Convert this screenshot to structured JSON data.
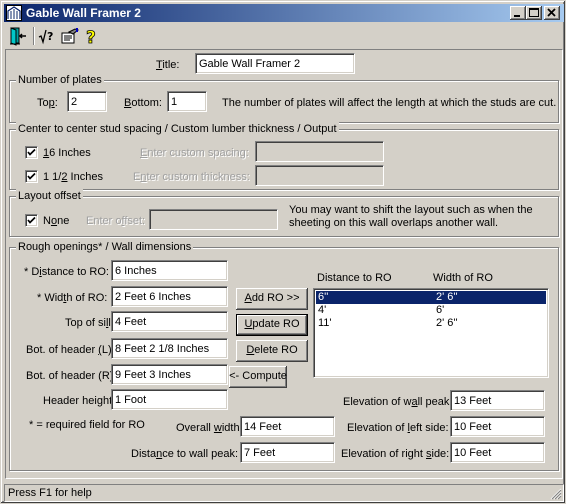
{
  "window": {
    "title": "Gable Wall Framer 2",
    "controls": {
      "minimize": "_",
      "maximize": "□",
      "close": "✕"
    }
  },
  "toolbar": {
    "icons": [
      "exit-door-icon",
      "calculator-sqrt-icon",
      "properties-icon",
      "help-icon"
    ]
  },
  "title_field": {
    "label": "Title:",
    "accel": "T",
    "label_rest": "itle:",
    "value": "Gable Wall Framer 2"
  },
  "plates": {
    "group_title": "Number of plates",
    "top_label_pre": "To",
    "top_label_accel": "p",
    "top_label_post": ":",
    "top_value": "2",
    "bottom_label_accel": "B",
    "bottom_label_post": "ottom:",
    "bottom_value": "1",
    "note": "The number of plates will affect the length at which the studs are cut."
  },
  "spacing": {
    "group_title": "Center to center stud spacing / Custom lumber thickness / Output",
    "spacing_check": {
      "accel": "1",
      "rest": "6 Inches",
      "checked": true
    },
    "thickness_check": {
      "pre": "1 1/",
      "accel": "2",
      "rest": " Inches",
      "checked": true
    },
    "custom_spacing_label_accel": "E",
    "custom_spacing_label_rest": "nter custom spacing:",
    "custom_spacing_value": "",
    "custom_thickness_label_pre": "E",
    "custom_thickness_label_accel": "n",
    "custom_thickness_label_rest": "ter custom thickness:",
    "custom_thickness_value": ""
  },
  "layout": {
    "group_title": "Layout offset",
    "none_check": {
      "pre": "N",
      "accel": "o",
      "rest": "ne",
      "checked": true
    },
    "offset_label_pre": "Enter o",
    "offset_label_accel": "f",
    "offset_label_rest": "fset:",
    "offset_value": "",
    "note_line1": "You may want to shift the layout such as when the",
    "note_line2": "sheeting on this wall overlaps another wall."
  },
  "rough": {
    "group_title": "Rough openings* / Wall dimensions",
    "distance_label_pre": "* D",
    "distance_label_accel": "i",
    "distance_label_rest": "stance to RO:",
    "distance_value": "6 Inches",
    "width_label_pre": "* Wid",
    "width_label_accel": "t",
    "width_label_rest": "h of RO:",
    "width_value": "2 Feet 6 Inches",
    "sill_label_pre": "Top of si",
    "sill_label_accel": "l",
    "sill_label_rest": "l:",
    "sill_value": "4 Feet",
    "header_l_label_pre": "Bot. of header ",
    "header_l_label_accel": "(",
    "header_l_label_rest": "L):",
    "header_l_value": "8 Feet 2 1/8 Inches",
    "header_r_label": "Bot. of header (R):",
    "header_r_value": "9 Feet 3 Inches",
    "header_h_label_pre": "Header hei",
    "header_h_label_accel": "g",
    "header_h_label_rest": "ht:",
    "header_h_value": "1 Foot",
    "required_note": "* = required field for RO",
    "buttons": {
      "add_accel": "A",
      "add_rest": "dd RO >>",
      "update_accel": "U",
      "update_rest": "pdate RO",
      "delete_accel": "D",
      "delete_rest": "elete RO",
      "compute": "<- Compute"
    },
    "list": {
      "headers": [
        "Distance to RO",
        "Width of RO"
      ],
      "rows": [
        {
          "distance": "6''",
          "width": "2' 6''",
          "selected": true
        },
        {
          "distance": "4'",
          "width": "6'",
          "selected": false
        },
        {
          "distance": "11'",
          "width": "2' 6''",
          "selected": false
        }
      ]
    },
    "overall_width_label_pre": "Overall ",
    "overall_width_label_accel": "w",
    "overall_width_label_rest": "idth:",
    "overall_width_value": "14 Feet",
    "peak_dist_label_pre": "Dista",
    "peak_dist_label_accel": "n",
    "peak_dist_label_rest": "ce to wall peak:",
    "peak_dist_value": "7 Feet",
    "elev_peak_label_pre": "Elevation of w",
    "elev_peak_label_accel": "a",
    "elev_peak_label_rest": "ll peak:",
    "elev_peak_value": "13 Feet",
    "elev_left_label_pre": "Elevation of ",
    "elev_left_label_accel": "l",
    "elev_left_label_rest": "eft side:",
    "elev_left_value": "10 Feet",
    "elev_right_label_pre": "Elevation of right ",
    "elev_right_label_accel": "s",
    "elev_right_label_rest": "ide:",
    "elev_right_value": "10 Feet"
  },
  "status": {
    "text": "Press F1 for help"
  },
  "colors": {
    "title_start": "#0a246a",
    "title_end": "#a6caf0",
    "face": "#d4d0c8",
    "selection": "#0a246a"
  }
}
